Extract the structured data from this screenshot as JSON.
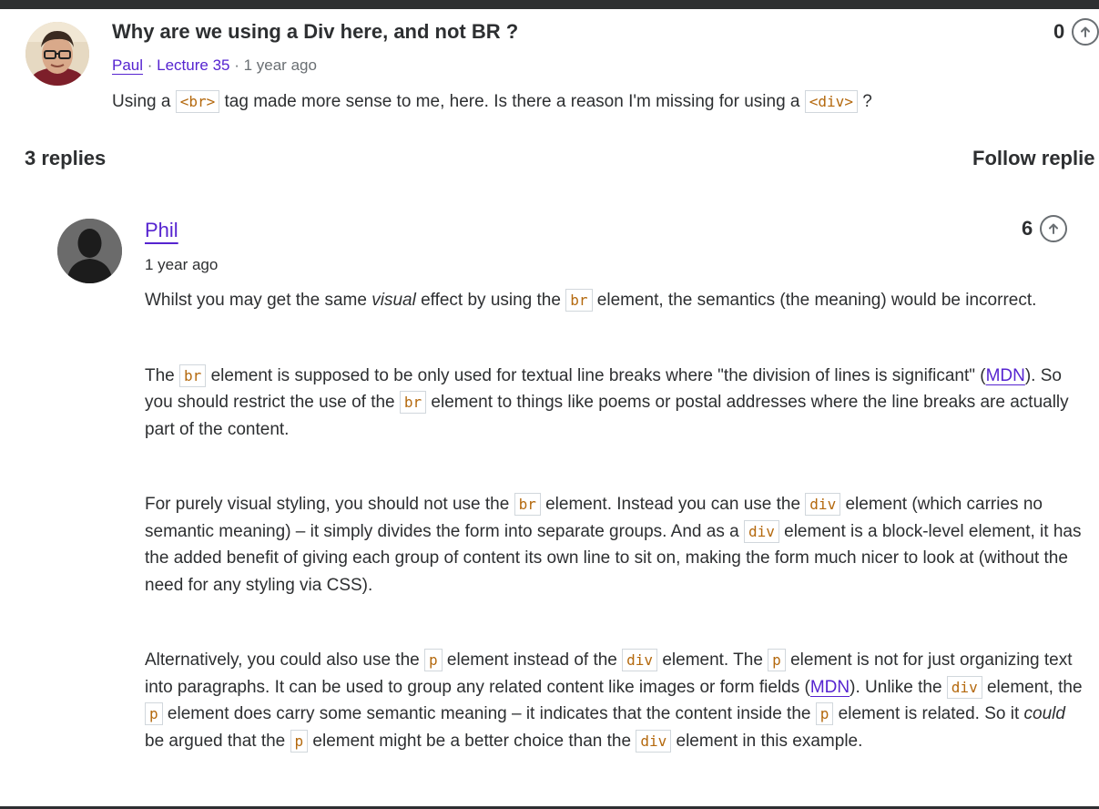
{
  "question": {
    "title": "Why are we using a Div here, and not BR ?",
    "author": "Paul",
    "sep1": " · ",
    "lecture": "Lecture 35",
    "sep2": " · ",
    "time": "1 year ago",
    "body_before": "Using a ",
    "code1": "<br>",
    "body_middle": " tag made more sense to me, here. Is there a reason I'm missing for using a ",
    "code2": "<div>",
    "body_after": " ?",
    "votes": "0"
  },
  "replies_header": {
    "count_label": "3 replies",
    "follow_label": "Follow replie"
  },
  "reply": {
    "author": "Phil",
    "time": "1 year ago",
    "votes": "6",
    "p1": {
      "t1": "Whilst you may get the same ",
      "em1": "visual",
      "t2": " effect by using the ",
      "c1": "br",
      "t3": " element, the semantics (the meaning) would be incorrect."
    },
    "p2": {
      "t1": "The ",
      "c1": "br",
      "t2": " element is supposed to be only used for textual line breaks where \"the division of lines is significant\" (",
      "link1": "MDN",
      "t3": "). So you should restrict the use of the ",
      "c2": "br",
      "t4": " element to things like poems or postal addresses where the line breaks are actually part of the content."
    },
    "p3": {
      "t1": "For purely visual styling, you should not use the ",
      "c1": "br",
      "t2": " element. Instead you can use the ",
      "c2": "div",
      "t3": " element (which carries no semantic meaning) – it simply divides the form into separate groups. And as a ",
      "c3": "div",
      "t4": " element is a block-level element, it has the added benefit of giving each group of content its own line to sit on, making the form much nicer to look at (without the need for any styling via CSS)."
    },
    "p4": {
      "t1": "Alternatively, you could also use the ",
      "c1": "p",
      "t2": " element instead of the ",
      "c2": "div",
      "t3": " element. The ",
      "c3": "p",
      "t4": " element is not for just organizing text into paragraphs. It can be used to group any related content like images or form fields (",
      "link1": "MDN",
      "t5": "). Unlike the ",
      "c4": "div",
      "t6": " element, the ",
      "c5": "p",
      "t7": " element does carry some semantic meaning – it indicates that the content inside the ",
      "c6": "p",
      "t8": " element is related. So it ",
      "em1": "could",
      "t9": " be argued that the ",
      "c7": "p",
      "t10": " element might be a better choice than the ",
      "c8": "div",
      "t11": " element in this example."
    }
  },
  "icons": {
    "upvote": "arrow-up-circle-icon",
    "question_avatar": "user-photo-avatar",
    "reply_avatar": "default-user-silhouette"
  },
  "colors": {
    "accent": "#5624d0",
    "code_text": "#b4690e",
    "text": "#2d2f31",
    "muted": "#6a6f73"
  }
}
